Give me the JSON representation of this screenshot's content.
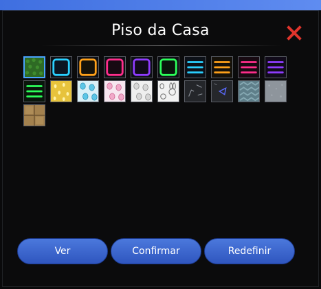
{
  "dialog": {
    "title": "Piso da Casa"
  },
  "icons": {
    "close": "close-icon"
  },
  "colors": {
    "accent": "#3f6fe0",
    "close": "#e0342c",
    "button": "#3a63cc",
    "selected_border": "#4aa3ff"
  },
  "tiles": [
    {
      "name": "grass",
      "selected": true
    },
    {
      "name": "neon-frame-cyan"
    },
    {
      "name": "neon-frame-orange"
    },
    {
      "name": "neon-frame-pink"
    },
    {
      "name": "neon-frame-purple"
    },
    {
      "name": "neon-frame-green"
    },
    {
      "name": "neon-stripes-cyan"
    },
    {
      "name": "neon-stripes-orange"
    },
    {
      "name": "neon-stripes-pink"
    },
    {
      "name": "neon-stripes-purple"
    },
    {
      "name": "neon-stripes-green"
    },
    {
      "name": "pattern-yellow"
    },
    {
      "name": "pattern-blue-eggs"
    },
    {
      "name": "pattern-pink-eggs"
    },
    {
      "name": "pattern-gray-eggs"
    },
    {
      "name": "pattern-bunny"
    },
    {
      "name": "dark-lines"
    },
    {
      "name": "dark-triangle"
    },
    {
      "name": "teal-herringbone"
    },
    {
      "name": "gray-stone"
    },
    {
      "name": "wood-planks"
    }
  ],
  "buttons": {
    "view": "Ver",
    "confirm": "Confirmar",
    "reset": "Redefinir"
  }
}
